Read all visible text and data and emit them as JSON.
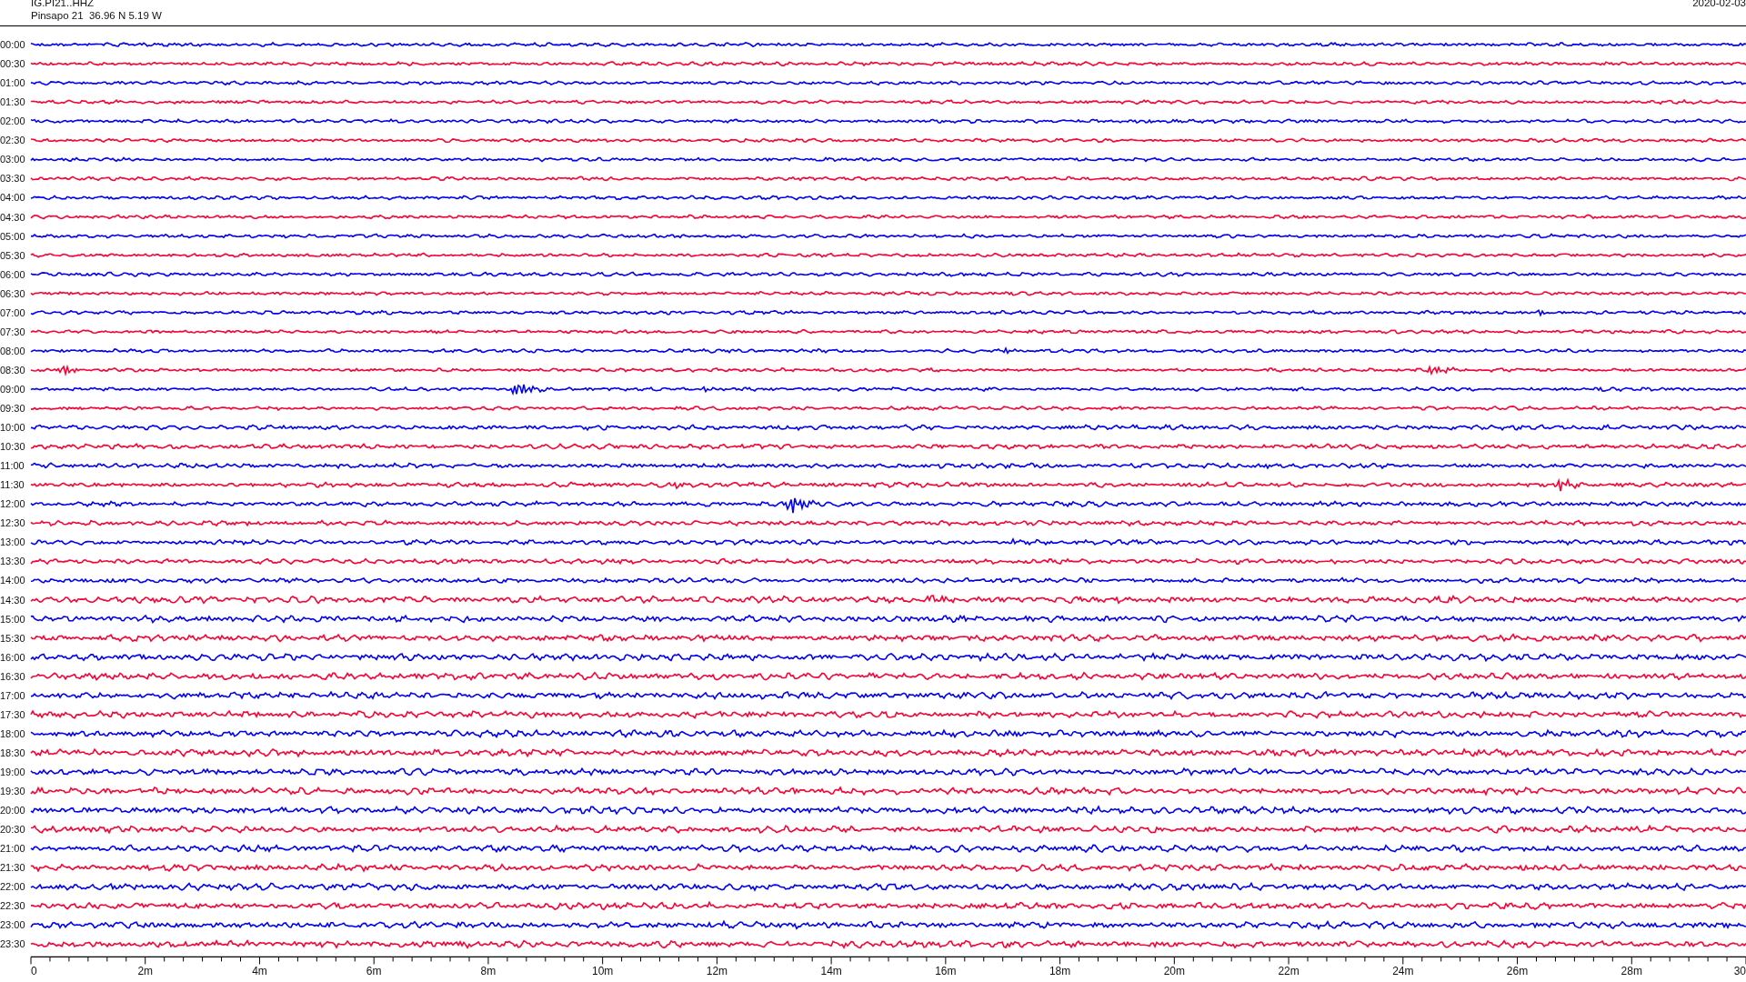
{
  "header": {
    "station": "IG.PI21..HHZ",
    "location": "Pinsapo 21  36.96 N 5.19 W",
    "date": "2020-02-03"
  },
  "rows": [
    {
      "time": "00:00",
      "color": "#0000ff"
    },
    {
      "time": "00:30",
      "color": "#ff0033"
    },
    {
      "time": "01:00",
      "color": "#0000ff"
    },
    {
      "time": "01:30",
      "color": "#ff0033"
    },
    {
      "time": "02:00",
      "color": "#0000ff"
    },
    {
      "time": "02:30",
      "color": "#ff0033"
    },
    {
      "time": "03:00",
      "color": "#0000ff"
    },
    {
      "time": "03:30",
      "color": "#ff0033"
    },
    {
      "time": "04:00",
      "color": "#0000ff"
    },
    {
      "time": "04:30",
      "color": "#ff0033"
    },
    {
      "time": "05:00",
      "color": "#0000ff"
    },
    {
      "time": "05:30",
      "color": "#ff0033"
    },
    {
      "time": "06:00",
      "color": "#0000ff"
    },
    {
      "time": "06:30",
      "color": "#ff0033"
    },
    {
      "time": "07:00",
      "color": "#0000ff"
    },
    {
      "time": "07:30",
      "color": "#ff0033"
    },
    {
      "time": "08:00",
      "color": "#0000ff"
    },
    {
      "time": "08:30",
      "color": "#ff0033"
    },
    {
      "time": "09:00",
      "color": "#0000ff"
    },
    {
      "time": "09:30",
      "color": "#ff0033"
    },
    {
      "time": "10:00",
      "color": "#0000ff"
    },
    {
      "time": "10:30",
      "color": "#ff0033"
    },
    {
      "time": "11:00",
      "color": "#0000ff"
    },
    {
      "time": "11:30",
      "color": "#ff0033"
    },
    {
      "time": "12:00",
      "color": "#0000ff"
    },
    {
      "time": "12:30",
      "color": "#ff0033"
    },
    {
      "time": "13:00",
      "color": "#0000ff"
    },
    {
      "time": "13:30",
      "color": "#ff0033"
    },
    {
      "time": "14:00",
      "color": "#0000ff"
    },
    {
      "time": "14:30",
      "color": "#ff0033"
    },
    {
      "time": "15:00",
      "color": "#0000ff"
    },
    {
      "time": "15:30",
      "color": "#ff0033"
    },
    {
      "time": "16:00",
      "color": "#0000ff"
    },
    {
      "time": "16:30",
      "color": "#ff0033"
    },
    {
      "time": "17:00",
      "color": "#0000ff"
    },
    {
      "time": "17:30",
      "color": "#ff0033"
    },
    {
      "time": "18:00",
      "color": "#0000ff"
    },
    {
      "time": "18:30",
      "color": "#ff0033"
    },
    {
      "time": "19:00",
      "color": "#0000ff"
    },
    {
      "time": "19:30",
      "color": "#ff0033"
    },
    {
      "time": "20:00",
      "color": "#0000ff"
    },
    {
      "time": "20:30",
      "color": "#ff0033"
    },
    {
      "time": "21:00",
      "color": "#0000ff"
    },
    {
      "time": "21:30",
      "color": "#ff0033"
    },
    {
      "time": "22:00",
      "color": "#0000ff"
    },
    {
      "time": "22:30",
      "color": "#ff0033"
    },
    {
      "time": "23:00",
      "color": "#0000ff"
    },
    {
      "time": "23:30",
      "color": "#ff0033"
    }
  ],
  "axis": {
    "labels": [
      "0",
      "2m",
      "4m",
      "6m",
      "8m",
      "10m",
      "12m",
      "14m",
      "16m",
      "18m",
      "20m",
      "22m",
      "24m",
      "26m",
      "28m",
      "30"
    ]
  }
}
